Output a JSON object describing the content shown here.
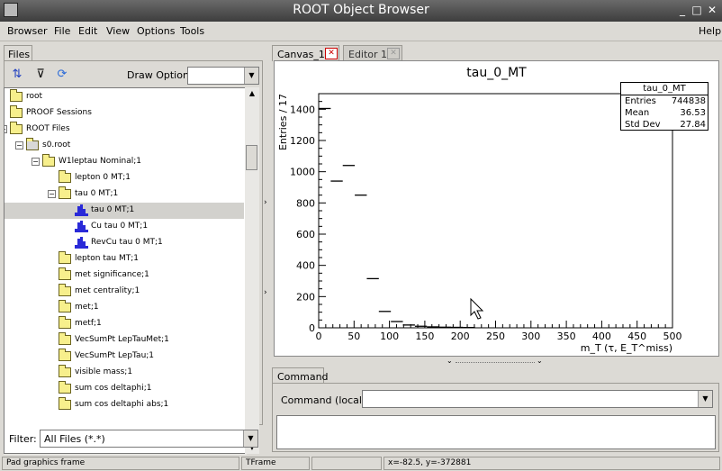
{
  "window": {
    "title": "ROOT Object Browser",
    "buttons": [
      "_",
      "□",
      "✕"
    ]
  },
  "menu": {
    "left": [
      "Browser",
      "File",
      "Edit",
      "View",
      "Options",
      "Tools"
    ],
    "right": "Help"
  },
  "left_panel": {
    "tab": "Files",
    "draw_option_label": "Draw Option:",
    "draw_option_value": "",
    "filter_label": "Filter:",
    "filter_value": "All Files (*.*)"
  },
  "tree": [
    {
      "label": "root",
      "type": "folder",
      "depth": 0
    },
    {
      "label": "PROOF Sessions",
      "type": "folder",
      "depth": 0
    },
    {
      "label": "ROOT Files",
      "type": "folder",
      "depth": 0,
      "expanded": true
    },
    {
      "label": "s0.root",
      "type": "file",
      "depth": 1,
      "expanded": true
    },
    {
      "label": "W1leptau Nominal;1",
      "type": "folder",
      "depth": 2,
      "expanded": true
    },
    {
      "label": "lepton 0 MT;1",
      "type": "folder",
      "depth": 3
    },
    {
      "label": "tau 0 MT;1",
      "type": "folder",
      "depth": 3,
      "expanded": true
    },
    {
      "label": "tau 0 MT;1",
      "type": "hist",
      "depth": 4,
      "selected": true
    },
    {
      "label": "Cu tau 0 MT;1",
      "type": "hist",
      "depth": 4
    },
    {
      "label": "RevCu tau 0 MT;1",
      "type": "hist",
      "depth": 4
    },
    {
      "label": "lepton tau MT;1",
      "type": "folder",
      "depth": 3
    },
    {
      "label": "met significance;1",
      "type": "folder",
      "depth": 3
    },
    {
      "label": "met centrality;1",
      "type": "folder",
      "depth": 3
    },
    {
      "label": "met;1",
      "type": "folder",
      "depth": 3
    },
    {
      "label": "metf;1",
      "type": "folder",
      "depth": 3
    },
    {
      "label": "VecSumPt LepTauMet;1",
      "type": "folder",
      "depth": 3
    },
    {
      "label": "VecSumPt LepTau;1",
      "type": "folder",
      "depth": 3
    },
    {
      "label": "visible mass;1",
      "type": "folder",
      "depth": 3
    },
    {
      "label": "sum cos deltaphi;1",
      "type": "folder",
      "depth": 3
    },
    {
      "label": "sum cos deltaphi abs;1",
      "type": "folder",
      "depth": 3
    }
  ],
  "tabs": [
    {
      "label": "Canvas_1",
      "close": "✕"
    },
    {
      "label": "Editor 1",
      "close": "✕"
    }
  ],
  "canvas": {
    "stats": {
      "title": "tau_0_MT",
      "rows": [
        {
          "k": "Entries",
          "v": "744838"
        },
        {
          "k": "Mean",
          "v": "36.53"
        },
        {
          "k": "Std Dev",
          "v": "27.84"
        }
      ]
    }
  },
  "chart_data": {
    "type": "bar",
    "title": "tau_0_MT",
    "xlabel": "m_T (τ, E_T^miss)",
    "ylabel": "Entries / 17",
    "xlim": [
      0,
      500
    ],
    "ylim": [
      0,
      1500
    ],
    "xticks": [
      0,
      50,
      100,
      150,
      200,
      250,
      300,
      350,
      400,
      450,
      500
    ],
    "yticks": [
      0,
      200,
      400,
      600,
      800,
      1000,
      1200,
      1400
    ],
    "bin_width": 17,
    "bins": [
      {
        "x0": 0,
        "y": 1405
      },
      {
        "x0": 17,
        "y": 940
      },
      {
        "x0": 34,
        "y": 1040
      },
      {
        "x0": 51,
        "y": 850
      },
      {
        "x0": 68,
        "y": 315
      },
      {
        "x0": 85,
        "y": 105
      },
      {
        "x0": 102,
        "y": 40
      },
      {
        "x0": 119,
        "y": 18
      },
      {
        "x0": 136,
        "y": 10
      },
      {
        "x0": 153,
        "y": 6
      },
      {
        "x0": 170,
        "y": 4
      },
      {
        "x0": 187,
        "y": 3
      },
      {
        "x0": 204,
        "y": 2
      }
    ]
  },
  "command": {
    "tab": "Command",
    "label": "Command (local):",
    "value": ""
  },
  "status": [
    "Pad graphics frame",
    "TFrame",
    "",
    "x=-82.5, y=-372881"
  ]
}
